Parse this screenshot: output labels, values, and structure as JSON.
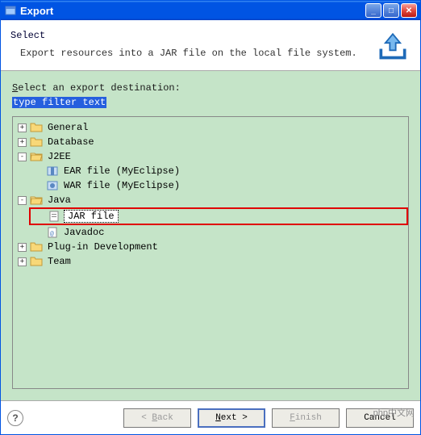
{
  "window": {
    "title": "Export"
  },
  "header": {
    "heading": "Select",
    "subheading": "Export resources into a JAR file on the local file system."
  },
  "body": {
    "dest_label_prefix": "S",
    "dest_label_rest": "elect an export destination:",
    "filter_text": "type filter text"
  },
  "tree": {
    "general": "General",
    "database": "Database",
    "j2ee": "J2EE",
    "ear_file": "EAR file (MyEclipse)",
    "war_file": "WAR file (MyEclipse)",
    "java": "Java",
    "jar_file": "JAR file",
    "javadoc": "Javadoc",
    "plugin_dev": "Plug-in Development",
    "team": "Team"
  },
  "buttons": {
    "back_u": "B",
    "back_rest": "ack",
    "next_u": "N",
    "next_rest": "ext",
    "finish_u": "F",
    "finish_rest": "inish",
    "cancel": "Cancel",
    "lt": "< ",
    "gt": " >"
  },
  "watermark": "php中文网"
}
